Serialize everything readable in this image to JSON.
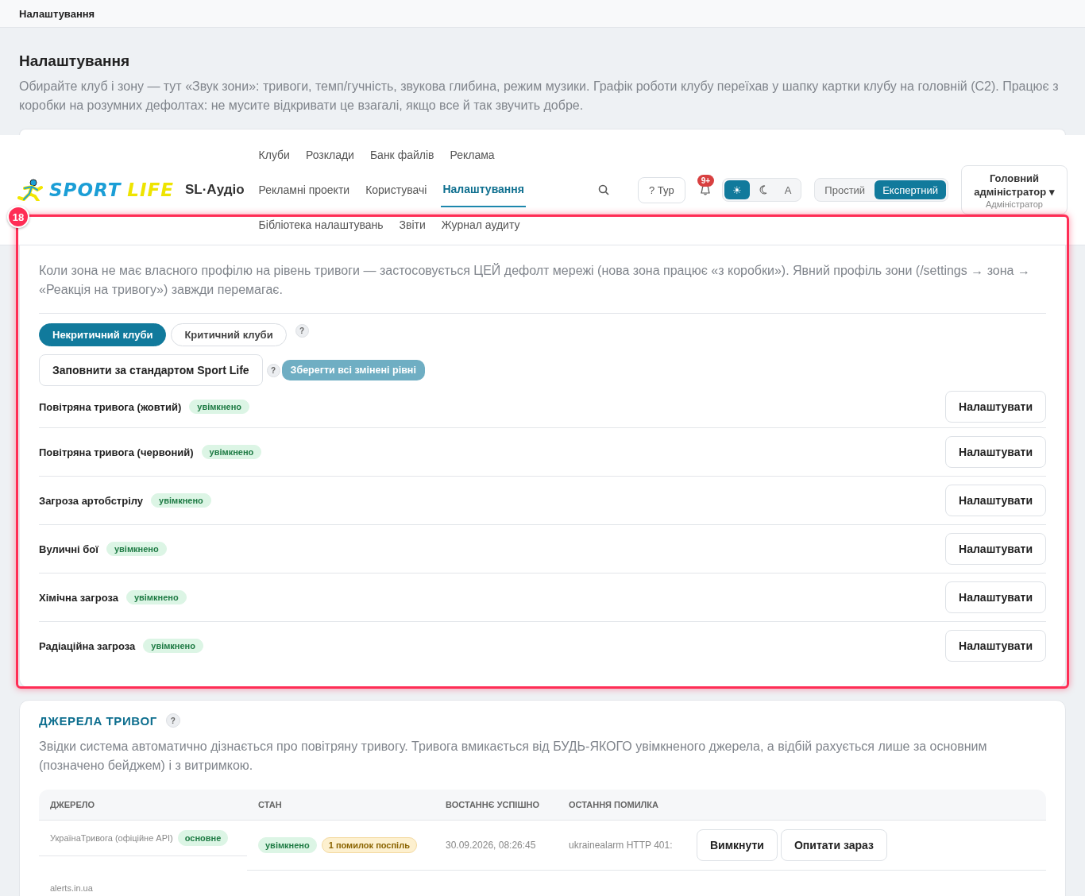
{
  "topbar": {
    "title": "Налаштування"
  },
  "intro": {
    "heading": "Налаштування",
    "description": "Обирайте клуб і зону — тут «Звук зони»: тривоги, темп/гучність, звукова глибина, режим музики. Графік роботи клубу переїхав у шапку картки клубу на головній (C2). Працює з коробки на розумних дефолтах: не мусите відкривати це взагалі, якщо все й так звучить добре."
  },
  "header": {
    "logo": {
      "word1": "SPORT",
      "word2": "LIFE"
    },
    "app_name": "SL·Аудіо",
    "nav": [
      [
        {
          "label": "Клуби",
          "selected": false
        },
        {
          "label": "Розклади",
          "selected": false
        },
        {
          "label": "Банк файлів",
          "selected": false
        },
        {
          "label": "Реклама",
          "selected": false
        }
      ],
      [
        {
          "label": "Рекламні проекти",
          "selected": false
        },
        {
          "label": "Користувачі",
          "selected": false
        },
        {
          "label": "Налаштування",
          "selected": true
        }
      ],
      [
        {
          "label": "Бібліотека налаштувань",
          "selected": false
        },
        {
          "label": "Звіти",
          "selected": false
        },
        {
          "label": "Журнал аудиту",
          "selected": false
        }
      ]
    ],
    "tour_button": "? Тур",
    "notifications_badge": "9+",
    "theme_options": [
      {
        "kind": "light",
        "label": "☀",
        "selected": true
      },
      {
        "kind": "dark",
        "selected": false
      },
      {
        "kind": "auto",
        "label": "A",
        "selected": false
      }
    ],
    "modes": [
      {
        "label": "Простий",
        "selected": false
      },
      {
        "label": "Експертний",
        "selected": true
      }
    ],
    "user": {
      "name": "Головний адміністратор ▾",
      "role": "Адміністратор"
    }
  },
  "alert_defaults": {
    "description": "Коли зона не має власного профілю на рівень тривоги — застосовується ЦЕЙ дефолт мережі (нова зона працює «з коробки»). Явний профіль зони (/settings → зона → «Реакція на тривогу») завжди перемагає.",
    "tabs": [
      {
        "label": "Некритичний клуби",
        "selected": true
      },
      {
        "label": "Критичний клуби",
        "selected": false
      }
    ],
    "help_mark": "?",
    "fill_button": "Заповнити за стандартом Sport Life",
    "fill_help": "?",
    "save_button": {
      "label": "Зберегти всі змінені рівні",
      "disabled": true
    },
    "levels": [
      {
        "name": "Повітряна тривога (жовтий)",
        "status": "увімкнено",
        "enabled": true,
        "action": "Налаштувати"
      },
      {
        "name": "Повітряна тривога (червоний)",
        "status": "увімкнено",
        "enabled": true,
        "action": "Налаштувати"
      },
      {
        "name": "Загроза артобстрілу",
        "status": "увімкнено",
        "enabled": true,
        "action": "Налаштувати"
      },
      {
        "name": "Вуличні бої",
        "status": "увімкнено",
        "enabled": true,
        "action": "Налаштувати"
      },
      {
        "name": "Хімічна загроза",
        "status": "увімкнено",
        "enabled": true,
        "action": "Налаштувати"
      },
      {
        "name": "Радіаційна загроза",
        "status": "увімкнено",
        "enabled": true,
        "action": "Налаштувати"
      }
    ]
  },
  "alert_sources": {
    "title": "ДЖЕРЕЛА ТРИВОГ",
    "help_mark": "?",
    "description": "Звідки система автоматично дізнається про повітряну тривогу. Тривога вмикається від БУДЬ-ЯКОГО увімкненого джерела, а відбій рахується лише за основним (позначено бейджем) і з витримкою.",
    "columns": [
      "ДЖЕРЕЛО",
      "СТАН",
      "ВОСТАННЄ УСПІШНО",
      "ОСТАННЯ ПОМИЛКА"
    ],
    "rows": [
      {
        "source": "УкраїнаТривога (офіційне API)",
        "source_badge": "основне",
        "states": [
          {
            "kind": "ok",
            "label": "увімкнено"
          },
          {
            "kind": "warning",
            "label": "1 помилок поспіль"
          }
        ],
        "last_success": "30.09.2026, 08:26:45",
        "last_error": "ukrainealarm HTTP 401:",
        "actions": [
          "Вимкнути",
          "Опитати зараз"
        ]
      },
      {
        "source": "alerts.in.ua"
      }
    ]
  },
  "annotation": {
    "label": "18"
  }
}
